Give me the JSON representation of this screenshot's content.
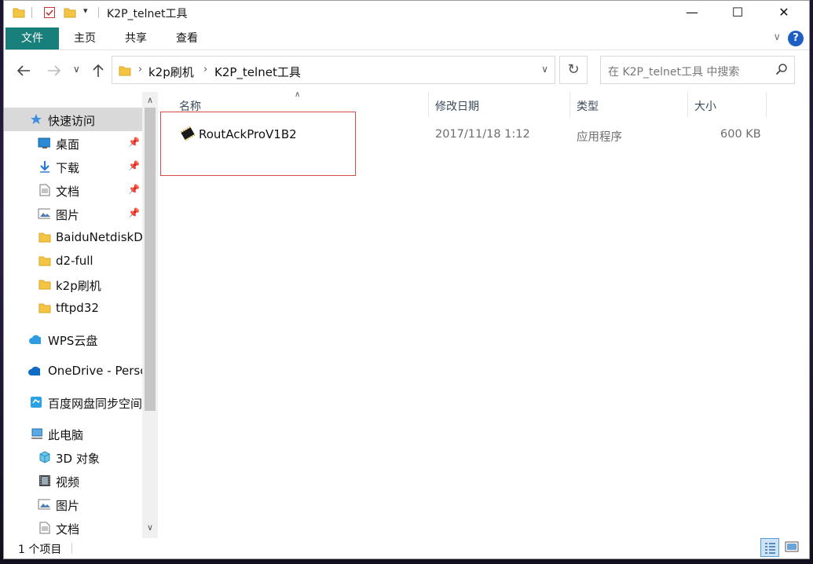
{
  "window": {
    "title": "K2P_telnet工具"
  },
  "title_buttons": {
    "minimize": "—",
    "maximize": "☐",
    "close": "✕"
  },
  "ribbon": {
    "file_tab": "文件",
    "tabs": [
      "主页",
      "共享",
      "查看"
    ],
    "help": "?"
  },
  "address": {
    "breadcrumbs": [
      "k2p刷机",
      "K2P_telnet工具"
    ]
  },
  "search": {
    "placeholder": "在 K2P_telnet工具 中搜索"
  },
  "sidebar": {
    "items": [
      {
        "label": "快速访问",
        "icon": "star-icon",
        "pinned": false,
        "selected": true
      },
      {
        "label": "桌面",
        "icon": "desktop-icon",
        "pinned": true
      },
      {
        "label": "下载",
        "icon": "download-icon",
        "pinned": true
      },
      {
        "label": "文档",
        "icon": "document-icon",
        "pinned": true
      },
      {
        "label": "图片",
        "icon": "picture-icon",
        "pinned": true
      },
      {
        "label": "BaiduNetdiskDo",
        "icon": "folder-icon",
        "pinned": false
      },
      {
        "label": "d2-full",
        "icon": "folder-icon",
        "pinned": false
      },
      {
        "label": "k2p刷机",
        "icon": "folder-icon",
        "pinned": false
      },
      {
        "label": "tftpd32",
        "icon": "folder-icon",
        "pinned": false
      },
      {
        "label": "WPS云盘",
        "icon": "cloud-icon",
        "pinned": false
      },
      {
        "label": "OneDrive - Persc",
        "icon": "onedrive-icon",
        "pinned": false
      },
      {
        "label": "百度网盘同步空间",
        "icon": "baidu-sync-icon",
        "pinned": false
      },
      {
        "label": "此电脑",
        "icon": "computer-icon",
        "pinned": false
      },
      {
        "label": "3D 对象",
        "icon": "cube-icon",
        "pinned": false
      },
      {
        "label": "视频",
        "icon": "video-icon",
        "pinned": false
      },
      {
        "label": "图片",
        "icon": "picture-icon",
        "pinned": false
      },
      {
        "label": "文档",
        "icon": "document-icon",
        "pinned": false
      }
    ]
  },
  "columns": [
    "名称",
    "修改日期",
    "类型",
    "大小"
  ],
  "files": [
    {
      "name": "RoutAckProV1B2",
      "modified": "2017/11/18 1:12",
      "type": "应用程序",
      "size": "600 KB",
      "icon": "executable-icon"
    }
  ],
  "status": {
    "item_count": "1 个项目"
  },
  "colors": {
    "file_tab": "#197f7a",
    "highlight_border": "#d64b4b",
    "selection": "#d9d9d9"
  }
}
